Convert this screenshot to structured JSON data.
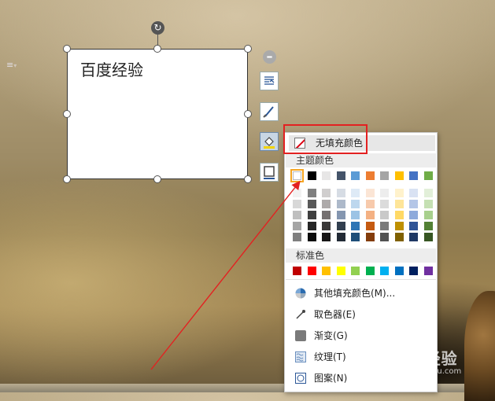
{
  "textbox": {
    "text": "百度经验"
  },
  "dropdown": {
    "no_fill_label": "无填充颜色",
    "theme_colors_label": "主题颜色",
    "theme_top_row": [
      "#ffffff",
      "#000000",
      "#e7e6e6",
      "#44546a",
      "#5b9bd5",
      "#ed7d31",
      "#a5a5a5",
      "#ffc000",
      "#4472c4",
      "#70ad47"
    ],
    "theme_shades": [
      [
        "#f2f2f2",
        "#7f7f7f",
        "#d0cece",
        "#d6dce4",
        "#deeaf6",
        "#fbe5d5",
        "#ededed",
        "#fff2cc",
        "#d9e2f3",
        "#e2efd9"
      ],
      [
        "#d8d8d8",
        "#595959",
        "#aeaaaa",
        "#adb9ca",
        "#bdd7ee",
        "#f7caac",
        "#dbdbdb",
        "#fee599",
        "#b4c6e7",
        "#c5e0b3"
      ],
      [
        "#bfbfbf",
        "#3f3f3f",
        "#757070",
        "#8496b0",
        "#9cc3e5",
        "#f4b183",
        "#c9c9c9",
        "#ffd965",
        "#8eaadb",
        "#a8d08d"
      ],
      [
        "#a5a5a5",
        "#262626",
        "#3a3838",
        "#323f4f",
        "#2e75b5",
        "#c55a11",
        "#7b7b7b",
        "#bf9000",
        "#2f5496",
        "#538135"
      ],
      [
        "#7f7f7f",
        "#0c0c0c",
        "#171616",
        "#222a35",
        "#1e4e79",
        "#833c0b",
        "#525252",
        "#7f6000",
        "#1f3864",
        "#375623"
      ]
    ],
    "standard_colors_label": "标准色",
    "standard_colors": [
      "#c00000",
      "#ff0000",
      "#ffc000",
      "#ffff00",
      "#92d050",
      "#00b050",
      "#00b0f0",
      "#0070c0",
      "#002060",
      "#7030a0"
    ],
    "menu_items": [
      {
        "label": "其他填充颜色(M)...",
        "icon": "color-wheel-icon"
      },
      {
        "label": "取色器(E)",
        "icon": "eyedropper-icon"
      },
      {
        "label": "渐变(G)",
        "icon": "gradient-icon"
      },
      {
        "label": "纹理(T)",
        "icon": "texture-icon"
      },
      {
        "label": "图案(N)",
        "icon": "pattern-icon"
      }
    ]
  },
  "side_tools": [
    "minus-icon",
    "text-wrap-icon",
    "pen-outline-icon",
    "fill-bucket-icon",
    "border-icon"
  ],
  "watermark": {
    "brand": "Bai度经验",
    "sub": "jingyan.baidu.com"
  },
  "colors": {
    "highlight_border": "#e32121",
    "arrow": "#e32121",
    "accent_selected": "#f5a623"
  }
}
